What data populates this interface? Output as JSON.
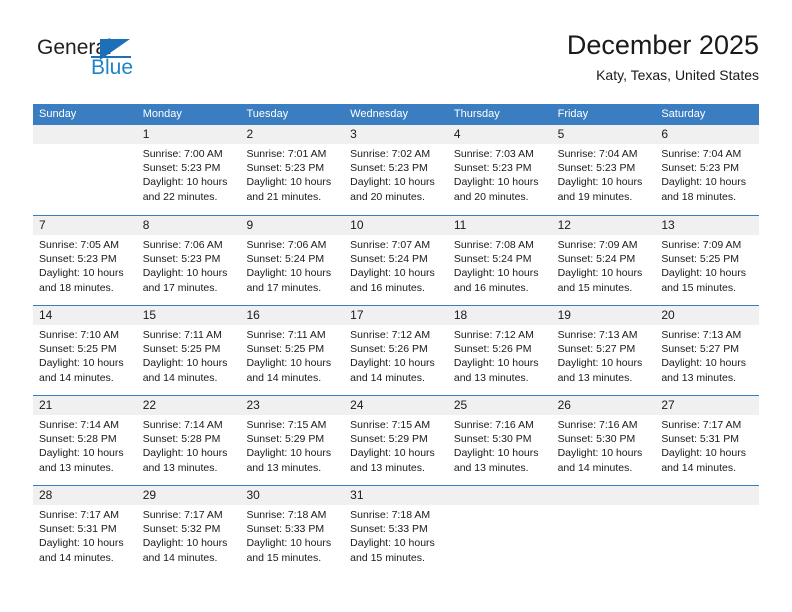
{
  "brand": {
    "name_dark": "General",
    "name_light": "Blue",
    "logo_icon": "triangle-icon"
  },
  "header": {
    "title": "December 2025",
    "subtitle": "Katy, Texas, United States"
  },
  "colors": {
    "header_blue": "#3a7dc0",
    "brand_blue": "#1f84c8",
    "day_band_gray": "#f0f0f0",
    "text": "#1a1a1a"
  },
  "weekdays": [
    "Sunday",
    "Monday",
    "Tuesday",
    "Wednesday",
    "Thursday",
    "Friday",
    "Saturday"
  ],
  "weeks": [
    [
      {
        "day": "",
        "lines": []
      },
      {
        "day": "1",
        "lines": [
          "Sunrise: 7:00 AM",
          "Sunset: 5:23 PM",
          "Daylight: 10 hours",
          "and 22 minutes."
        ]
      },
      {
        "day": "2",
        "lines": [
          "Sunrise: 7:01 AM",
          "Sunset: 5:23 PM",
          "Daylight: 10 hours",
          "and 21 minutes."
        ]
      },
      {
        "day": "3",
        "lines": [
          "Sunrise: 7:02 AM",
          "Sunset: 5:23 PM",
          "Daylight: 10 hours",
          "and 20 minutes."
        ]
      },
      {
        "day": "4",
        "lines": [
          "Sunrise: 7:03 AM",
          "Sunset: 5:23 PM",
          "Daylight: 10 hours",
          "and 20 minutes."
        ]
      },
      {
        "day": "5",
        "lines": [
          "Sunrise: 7:04 AM",
          "Sunset: 5:23 PM",
          "Daylight: 10 hours",
          "and 19 minutes."
        ]
      },
      {
        "day": "6",
        "lines": [
          "Sunrise: 7:04 AM",
          "Sunset: 5:23 PM",
          "Daylight: 10 hours",
          "and 18 minutes."
        ]
      }
    ],
    [
      {
        "day": "7",
        "lines": [
          "Sunrise: 7:05 AM",
          "Sunset: 5:23 PM",
          "Daylight: 10 hours",
          "and 18 minutes."
        ]
      },
      {
        "day": "8",
        "lines": [
          "Sunrise: 7:06 AM",
          "Sunset: 5:23 PM",
          "Daylight: 10 hours",
          "and 17 minutes."
        ]
      },
      {
        "day": "9",
        "lines": [
          "Sunrise: 7:06 AM",
          "Sunset: 5:24 PM",
          "Daylight: 10 hours",
          "and 17 minutes."
        ]
      },
      {
        "day": "10",
        "lines": [
          "Sunrise: 7:07 AM",
          "Sunset: 5:24 PM",
          "Daylight: 10 hours",
          "and 16 minutes."
        ]
      },
      {
        "day": "11",
        "lines": [
          "Sunrise: 7:08 AM",
          "Sunset: 5:24 PM",
          "Daylight: 10 hours",
          "and 16 minutes."
        ]
      },
      {
        "day": "12",
        "lines": [
          "Sunrise: 7:09 AM",
          "Sunset: 5:24 PM",
          "Daylight: 10 hours",
          "and 15 minutes."
        ]
      },
      {
        "day": "13",
        "lines": [
          "Sunrise: 7:09 AM",
          "Sunset: 5:25 PM",
          "Daylight: 10 hours",
          "and 15 minutes."
        ]
      }
    ],
    [
      {
        "day": "14",
        "lines": [
          "Sunrise: 7:10 AM",
          "Sunset: 5:25 PM",
          "Daylight: 10 hours",
          "and 14 minutes."
        ]
      },
      {
        "day": "15",
        "lines": [
          "Sunrise: 7:11 AM",
          "Sunset: 5:25 PM",
          "Daylight: 10 hours",
          "and 14 minutes."
        ]
      },
      {
        "day": "16",
        "lines": [
          "Sunrise: 7:11 AM",
          "Sunset: 5:25 PM",
          "Daylight: 10 hours",
          "and 14 minutes."
        ]
      },
      {
        "day": "17",
        "lines": [
          "Sunrise: 7:12 AM",
          "Sunset: 5:26 PM",
          "Daylight: 10 hours",
          "and 14 minutes."
        ]
      },
      {
        "day": "18",
        "lines": [
          "Sunrise: 7:12 AM",
          "Sunset: 5:26 PM",
          "Daylight: 10 hours",
          "and 13 minutes."
        ]
      },
      {
        "day": "19",
        "lines": [
          "Sunrise: 7:13 AM",
          "Sunset: 5:27 PM",
          "Daylight: 10 hours",
          "and 13 minutes."
        ]
      },
      {
        "day": "20",
        "lines": [
          "Sunrise: 7:13 AM",
          "Sunset: 5:27 PM",
          "Daylight: 10 hours",
          "and 13 minutes."
        ]
      }
    ],
    [
      {
        "day": "21",
        "lines": [
          "Sunrise: 7:14 AM",
          "Sunset: 5:28 PM",
          "Daylight: 10 hours",
          "and 13 minutes."
        ]
      },
      {
        "day": "22",
        "lines": [
          "Sunrise: 7:14 AM",
          "Sunset: 5:28 PM",
          "Daylight: 10 hours",
          "and 13 minutes."
        ]
      },
      {
        "day": "23",
        "lines": [
          "Sunrise: 7:15 AM",
          "Sunset: 5:29 PM",
          "Daylight: 10 hours",
          "and 13 minutes."
        ]
      },
      {
        "day": "24",
        "lines": [
          "Sunrise: 7:15 AM",
          "Sunset: 5:29 PM",
          "Daylight: 10 hours",
          "and 13 minutes."
        ]
      },
      {
        "day": "25",
        "lines": [
          "Sunrise: 7:16 AM",
          "Sunset: 5:30 PM",
          "Daylight: 10 hours",
          "and 13 minutes."
        ]
      },
      {
        "day": "26",
        "lines": [
          "Sunrise: 7:16 AM",
          "Sunset: 5:30 PM",
          "Daylight: 10 hours",
          "and 14 minutes."
        ]
      },
      {
        "day": "27",
        "lines": [
          "Sunrise: 7:17 AM",
          "Sunset: 5:31 PM",
          "Daylight: 10 hours",
          "and 14 minutes."
        ]
      }
    ],
    [
      {
        "day": "28",
        "lines": [
          "Sunrise: 7:17 AM",
          "Sunset: 5:31 PM",
          "Daylight: 10 hours",
          "and 14 minutes."
        ]
      },
      {
        "day": "29",
        "lines": [
          "Sunrise: 7:17 AM",
          "Sunset: 5:32 PM",
          "Daylight: 10 hours",
          "and 14 minutes."
        ]
      },
      {
        "day": "30",
        "lines": [
          "Sunrise: 7:18 AM",
          "Sunset: 5:33 PM",
          "Daylight: 10 hours",
          "and 15 minutes."
        ]
      },
      {
        "day": "31",
        "lines": [
          "Sunrise: 7:18 AM",
          "Sunset: 5:33 PM",
          "Daylight: 10 hours",
          "and 15 minutes."
        ]
      },
      {
        "day": "",
        "lines": []
      },
      {
        "day": "",
        "lines": []
      },
      {
        "day": "",
        "lines": []
      }
    ]
  ]
}
